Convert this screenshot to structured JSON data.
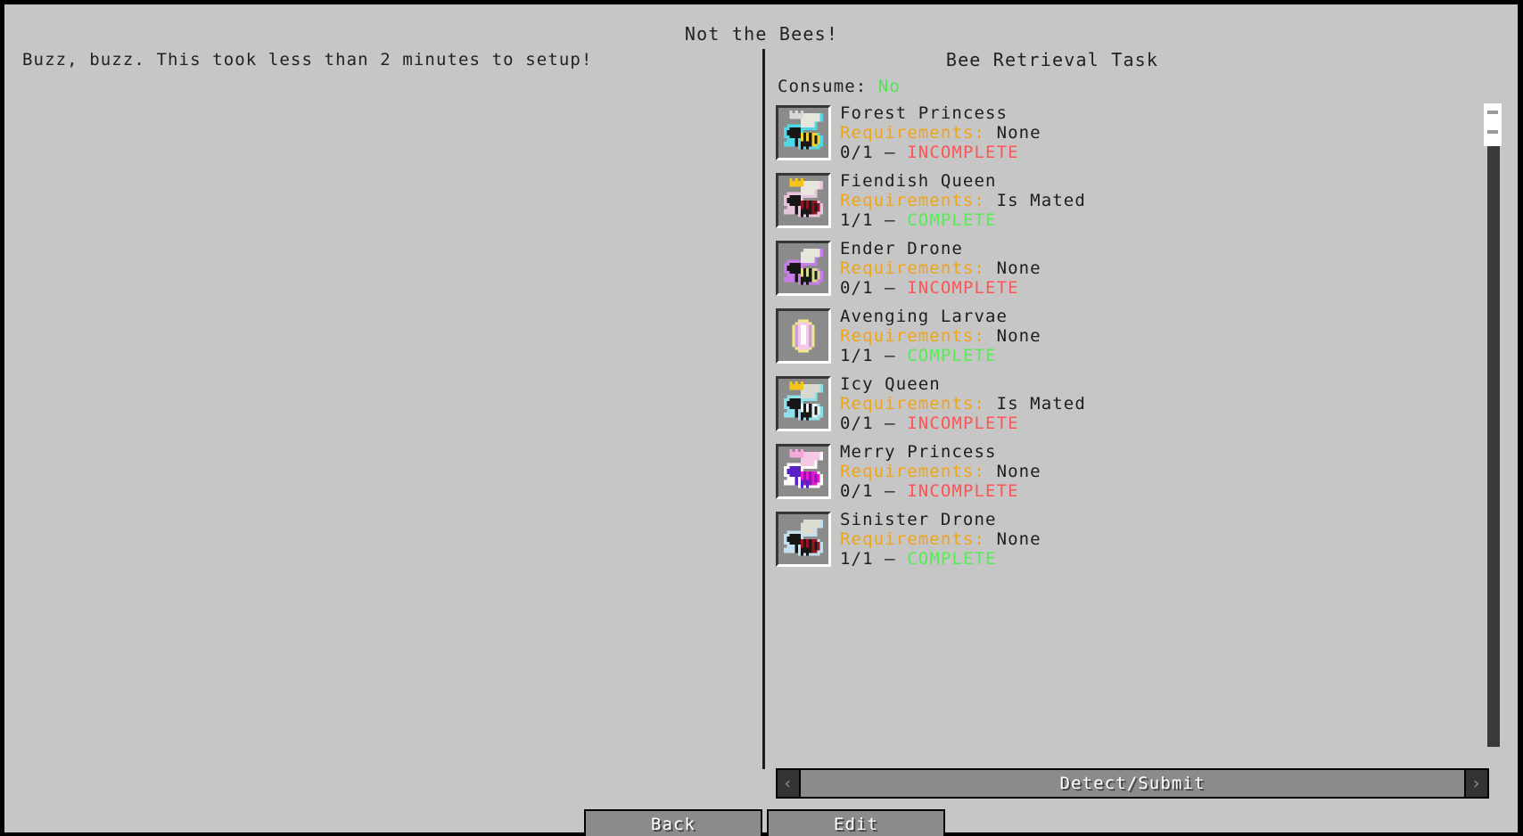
{
  "window": {
    "title": "Not the Bees!",
    "left_description": "Buzz, buzz. This took less than 2 minutes to setup!"
  },
  "panel": {
    "title": "Bee Retrieval Task",
    "consume_label": "Consume:",
    "consume_value": "No"
  },
  "labels": {
    "requirements_key": "Requirements:",
    "dash": "–"
  },
  "entries": [
    {
      "name": "Forest Princess",
      "requirements_key": "Requirements:",
      "requirements_value": "None",
      "count": "0/1",
      "dash": "–",
      "status": "INCOMPLETE",
      "complete": false,
      "icon": "bee-forest-princess-icon",
      "sprite": {
        "kind": "bee",
        "body": "#f2d22a",
        "stripe": "#1a1a1a",
        "head": "#161616",
        "wing": "#e6e6dc",
        "outline": "#4fd8e8",
        "crown": "#d8d8d8",
        "crown_visible": true
      }
    },
    {
      "name": "Fiendish Queen",
      "requirements_key": "Requirements:",
      "requirements_value": "Is Mated",
      "count": "1/1",
      "dash": "–",
      "status": "COMPLETE",
      "complete": true,
      "icon": "bee-fiendish-queen-icon",
      "sprite": {
        "kind": "bee",
        "body": "#8f1420",
        "stripe": "#1a1a1a",
        "head": "#161616",
        "wing": "#e6e6dc",
        "outline": "#e8c4dc",
        "crown": "#f5c518",
        "crown_visible": true
      }
    },
    {
      "name": "Ender Drone",
      "requirements_key": "Requirements:",
      "requirements_value": "None",
      "count": "0/1",
      "dash": "–",
      "status": "INCOMPLETE",
      "complete": false,
      "icon": "bee-ender-drone-icon",
      "sprite": {
        "kind": "bee",
        "body": "#d8dc8a",
        "stripe": "#1a1a1a",
        "head": "#161616",
        "wing": "#e6e6dc",
        "outline": "#c77de8",
        "crown": "#000000",
        "crown_visible": false
      }
    },
    {
      "name": "Avenging Larvae",
      "requirements_key": "Requirements:",
      "requirements_value": "None",
      "count": "1/1",
      "dash": "–",
      "status": "COMPLETE",
      "complete": true,
      "icon": "bee-avenging-larvae-icon",
      "sprite": {
        "kind": "larvae",
        "body": "#f6c8e8",
        "highlight": "#ffffff",
        "shade": "#c8a0e0",
        "outline": "#f2e88a"
      }
    },
    {
      "name": "Icy Queen",
      "requirements_key": "Requirements:",
      "requirements_value": "Is Mated",
      "count": "0/1",
      "dash": "–",
      "status": "INCOMPLETE",
      "complete": false,
      "icon": "bee-icy-queen-icon",
      "sprite": {
        "kind": "bee",
        "body": "#eef4f6",
        "stripe": "#1a1a1a",
        "head": "#161616",
        "wing": "#d8d8cc",
        "outline": "#8fe0ea",
        "crown": "#f5c518",
        "crown_visible": true
      }
    },
    {
      "name": "Merry Princess",
      "requirements_key": "Requirements:",
      "requirements_value": "None",
      "count": "0/1",
      "dash": "–",
      "status": "INCOMPLETE",
      "complete": false,
      "icon": "bee-merry-princess-icon",
      "sprite": {
        "kind": "bee",
        "body": "#e81ad0",
        "stripe": "#8f14b4",
        "head": "#5a20c8",
        "wing": "#f6c8e8",
        "outline": "#ffffff",
        "crown": "#f6a8d8",
        "crown_visible": true
      }
    },
    {
      "name": "Sinister Drone",
      "requirements_key": "Requirements:",
      "requirements_value": "None",
      "count": "1/1",
      "dash": "–",
      "status": "COMPLETE",
      "complete": true,
      "icon": "bee-sinister-drone-icon",
      "sprite": {
        "kind": "bee",
        "body": "#9a1420",
        "stripe": "#1a1a1a",
        "head": "#161616",
        "wing": "#ddddd2",
        "outline": "#bfe0ec",
        "crown": "#000000",
        "crown_visible": false
      }
    }
  ],
  "controls": {
    "prev_arrow": "‹",
    "next_arrow": "›",
    "submit_label": "Detect/Submit",
    "back_label": "Back",
    "edit_label": "Edit"
  },
  "colors": {
    "background": "#c6c6c6",
    "slot": "#8b8b8b",
    "requirements_key": "#f0a515",
    "incomplete": "#ff5555",
    "complete": "#55ec55",
    "consume_value": "#55e055",
    "text": "#1e1e1e"
  }
}
